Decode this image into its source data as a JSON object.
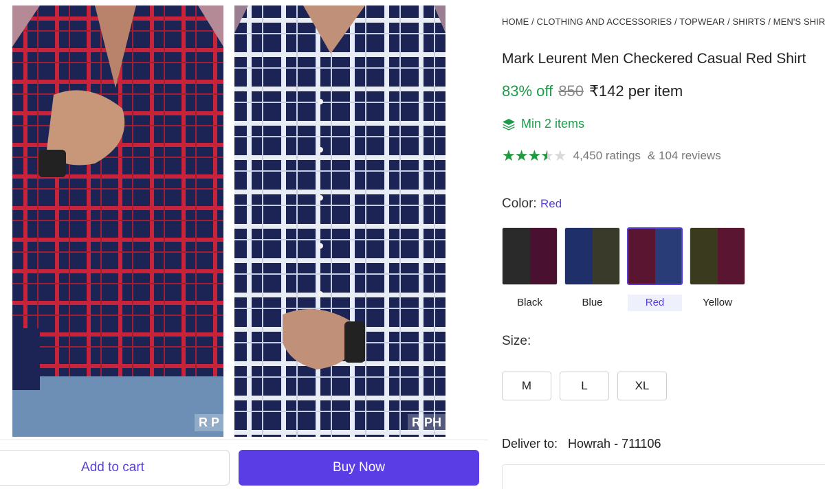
{
  "breadcrumb": "HOME / CLOTHING AND ACCESSORIES / TOPWEAR / SHIRTS / MEN'S SHIRT",
  "product": {
    "title": "Mark Leurent Men Checkered Casual Red Shirt",
    "discount": "83% off",
    "mrp": "850",
    "price": "₹142 per item",
    "min_items": "Min 2 items",
    "rating_value": 3.5,
    "ratings": "4,450 ratings",
    "reviews": "& 104 reviews"
  },
  "color": {
    "label": "Color:",
    "selected": "Red",
    "options": [
      {
        "name": "Black",
        "left": "#2a2a2a",
        "right": "#4a1030"
      },
      {
        "name": "Blue",
        "left": "#1e2f6a",
        "right": "#3a3a2a"
      },
      {
        "name": "Red",
        "left": "#5a1530",
        "right": "#2a3c78"
      },
      {
        "name": "Yellow",
        "left": "#3a3a1e",
        "right": "#5a1530"
      }
    ]
  },
  "size": {
    "label": "Size:",
    "options": [
      "M",
      "L",
      "XL"
    ]
  },
  "delivery": {
    "label": "Deliver to:",
    "location": "Howrah - 711106"
  },
  "actions": {
    "add_to_cart": "Add to cart",
    "buy_now": "Buy Now"
  },
  "gallery": {
    "watermark_1": "R P",
    "watermark_2": "R PH"
  },
  "colors": {
    "accent": "#5b3de6",
    "green": "#1c9c4a",
    "shirt_navy": "#1b2455",
    "shirt_red": "#c8233a",
    "shirt_white": "#e8ecf4"
  }
}
